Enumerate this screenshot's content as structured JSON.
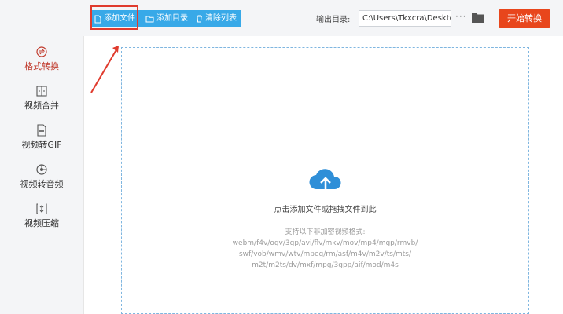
{
  "toolbar": {
    "add_file": "添加文件",
    "add_folder": "添加目录",
    "clear_list": "清除列表",
    "output_label": "输出目录:",
    "output_path": "C:\\Users\\Tkxcra\\Deskto",
    "more": "···",
    "start": "开始转换"
  },
  "sidebar": {
    "items": [
      {
        "label": "格式转换",
        "icon": "format-convert-icon",
        "active": true
      },
      {
        "label": "视频合并",
        "icon": "video-merge-icon",
        "active": false
      },
      {
        "label": "视频转GIF",
        "icon": "gif-icon",
        "active": false
      },
      {
        "label": "视频转音频",
        "icon": "audio-icon",
        "active": false
      },
      {
        "label": "视频压缩",
        "icon": "compress-icon",
        "active": false
      }
    ]
  },
  "dropzone": {
    "hint": "点击添加文件或拖拽文件到此",
    "formats_title": "支持以下非加密视频格式:",
    "formats_line1": "webm/f4v/ogv/3gp/avi/flv/mkv/mov/mp4/mgp/rmvb/",
    "formats_line2": "swf/vob/wmv/wtv/mpeg/rm/asf/m4v/m2v/ts/mts/",
    "formats_line3": "m2t/m2ts/dv/mxf/mpg/3gpp/aif/mod/m4s"
  },
  "colors": {
    "accent_blue": "#38a9e8",
    "start_orange": "#e8461c",
    "active_red": "#c0392b",
    "highlight_red": "#e03b2e"
  }
}
